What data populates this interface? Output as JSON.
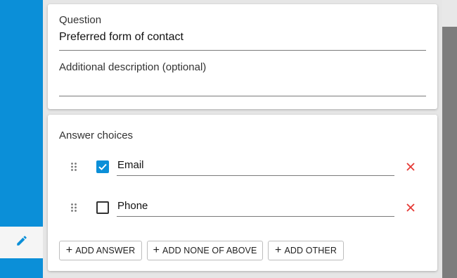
{
  "question_card": {
    "question_label": "Question",
    "question_value": "Preferred form of contact",
    "description_label": "Additional description (optional)",
    "description_value": ""
  },
  "answers_card": {
    "title": "Answer choices",
    "answers": [
      {
        "label": "Email",
        "checked": true
      },
      {
        "label": "Phone",
        "checked": false
      }
    ],
    "buttons": {
      "add_answer": "ADD ANSWER",
      "add_none_of_above": "ADD NONE OF ABOVE",
      "add_other": "ADD OTHER"
    }
  },
  "icons": {
    "edit": "pencil-icon",
    "drag": "drag-handle-icon",
    "remove": "close-icon",
    "add": "plus-icon"
  },
  "colors": {
    "accent": "#0b8fd8",
    "remove": "#e53935"
  }
}
